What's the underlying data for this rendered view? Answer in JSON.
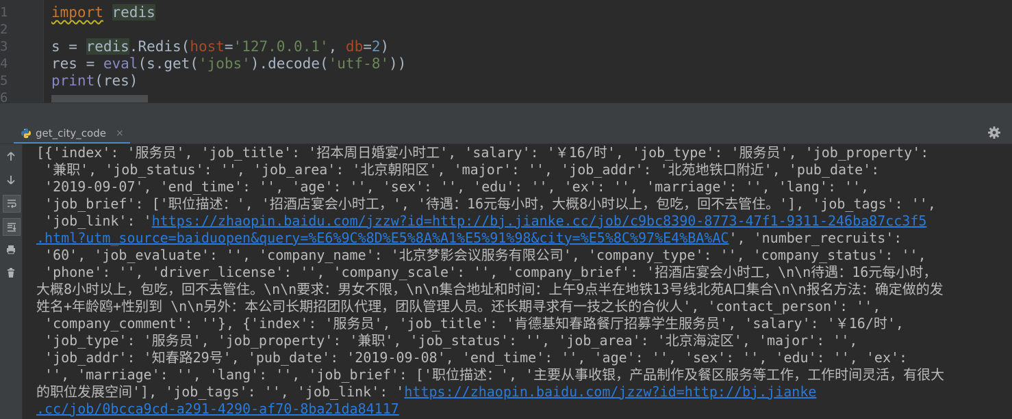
{
  "editor": {
    "line_numbers": [
      "1",
      "2",
      "3",
      "4",
      "5",
      "6"
    ],
    "code": {
      "l1_kw": "import",
      "l1_mod": "redis",
      "l3_a": "s = ",
      "l3_mod": "redis",
      "l3_b": ".Redis(",
      "l3_p1": "host",
      "l3_c": "=",
      "l3_s1": "'127.0.0.1'",
      "l3_d": ", ",
      "l3_p2": "db",
      "l3_e": "=",
      "l3_n": "2",
      "l3_f": ")",
      "l4_a": "res = ",
      "l4_bi": "eval",
      "l4_b": "(s.get(",
      "l4_s1": "'jobs'",
      "l4_c": ").decode(",
      "l4_s2": "'utf-8'",
      "l4_d": "))",
      "l5_bi": "print",
      "l5_a": "(res)"
    }
  },
  "run_panel": {
    "tab_label": "get_city_code",
    "tab_close": "×",
    "sidebar_icons": [
      "up-arrow-icon",
      "down-arrow-icon",
      "soft-wrap-icon",
      "scroll-to-end-icon",
      "print-icon",
      "trash-icon"
    ]
  },
  "console": {
    "l1": "[{'index': '服务员', 'job_title': '招本周日婚宴小时工', 'salary': '￥16/时', 'job_type': '服务员', 'job_property':",
    "l2": " '兼职', 'job_status': '', 'job_area': '北京朝阳区', 'major': '', 'job_addr': '北苑地铁口附近', 'pub_date':",
    "l3": " '2019-09-07', 'end_time': '', 'age': '', 'sex': '', 'edu': '', 'ex': '', 'marriage': '', 'lang': '',",
    "l4": " 'job_brief': ['职位描述：', '招酒店宴会小时工，', '待遇：16元每小时，大概8小时以上，包吃，回不去管住。'], 'job_tags': '',",
    "l5_pre": " 'job_link': '",
    "l5_link": "https://zhaopin.baidu.com/jzzw?id=http://bj.jianke.cc/job/c9bc8390-8773-47f1-9311-246ba87cc3f5",
    "l6_link": ".html?utm_source=baiduopen&query=%E6%9C%8D%E5%8A%A1%E5%91%98&city=%E5%8C%97%E4%BA%AC",
    "l6_post": "', 'number_recruits':",
    "l7": " '60', 'job_evaluate': '', 'company_name': '北京梦影会议服务有限公司', 'company_type': '', 'company_status': '',",
    "l8": " 'phone': '', 'driver_license': '', 'company_scale': '', 'company_brief': '招酒店宴会小时工，\\n\\n待遇：16元每小时，",
    "l9": "大概8小时以上，包吃，回不去管住。\\n\\n要求：男女不限，\\n\\n集合地址和时间：上午9点半在地铁13号线北苑A口集合\\n\\n报名方法：确定做的发",
    "l10": "姓名+年龄鸥+性别到 \\n\\n另外：本公司长期招团队代理，团队管理人员。还长期寻求有一技之长的合伙人', 'contact_person': '',",
    "l11": " 'company_comment': ''}, {'index': '服务员', 'job_title': '肯德基知春路餐厅招募学生服务员', 'salary': '￥16/时',",
    "l12": " 'job_type': '服务员', 'job_property': '兼职', 'job_status': '', 'job_area': '北京海淀区', 'major': '',",
    "l13": " 'job_addr': '知春路29号', 'pub_date': '2019-09-08', 'end_time': '', 'age': '', 'sex': '', 'edu': '', 'ex':",
    "l14": " '', 'marriage': '', 'lang': '', 'job_brief': ['职位描述：', '主要从事收银，产品制作及餐区服务等工作，工作时间灵活，有很大",
    "l15_pre": "的职位发展空间'], 'job_tags': '', 'job_link': '",
    "l15_link": "https://zhaopin.baidu.com/jzzw?id=http://bj.jianke",
    "l16_link": ".cc/job/0bcca9cd-a291-4290-af70-8ba21da84117"
  },
  "colors": {
    "editor_bg": "#2b2b2b",
    "gutter_bg": "#313335",
    "keyword": "#cc7832",
    "string": "#6a8759",
    "number": "#6897bb",
    "builtin": "#8888c6",
    "parameter": "#aa4926",
    "console_text": "#bbbbbb",
    "link": "#287bde"
  }
}
